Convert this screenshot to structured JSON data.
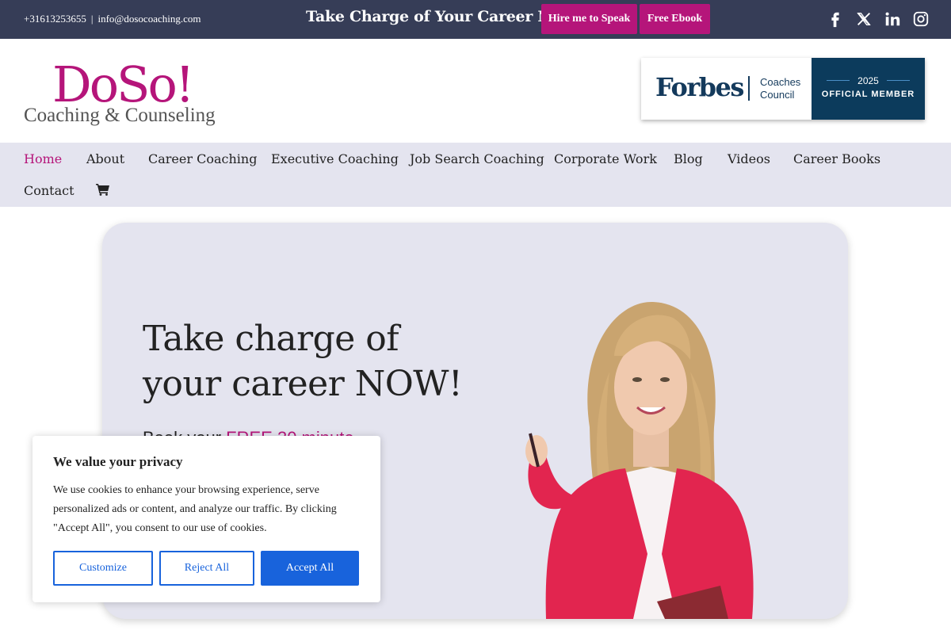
{
  "topbar": {
    "phone": "+31613253655",
    "separator": "|",
    "email": "info@dosocoaching.com",
    "cta": "Take Charge of Your Career Now!",
    "hire_button": "Hire me to Speak",
    "ebook_button": "Free Ebook",
    "social_icons": [
      "facebook-icon",
      "x-icon",
      "linkedin-icon",
      "instagram-icon"
    ]
  },
  "logo": {
    "main": "DoSo!",
    "sub": "Coaching & Counseling"
  },
  "forbes_badge": {
    "wordmark": "Forbes",
    "council_line1": "Coaches",
    "council_line2": "Council",
    "year": "2025",
    "member": "OFFICIAL MEMBER"
  },
  "nav": {
    "items": [
      "Home",
      "About",
      "Career Coaching",
      "Executive Coaching",
      "Job Search Coaching",
      "Corporate Work",
      "Blog",
      "Videos",
      "Career Books",
      "Contact"
    ],
    "active": "Home",
    "cart_icon": "shopping-cart-icon"
  },
  "hero": {
    "title_line1": "Take charge of",
    "title_line2": "your career NOW!",
    "sub_prefix": "Book your ",
    "sub_highlight": "FREE 30 minute"
  },
  "cookie": {
    "title": "We value your privacy",
    "text": "We use cookies to enhance your browsing experience, serve personalized ads or content, and analyze our traffic. By clicking \"Accept All\", you consent to our use of cookies.",
    "customize": "Customize",
    "reject": "Reject All",
    "accept": "Accept All"
  },
  "colors": {
    "topbar": "#363d57",
    "brand_magenta": "#b5157a",
    "nav_bg": "#e4e4ef",
    "forbes_navy": "#0c3b5c",
    "cookie_blue": "#1863dc"
  }
}
